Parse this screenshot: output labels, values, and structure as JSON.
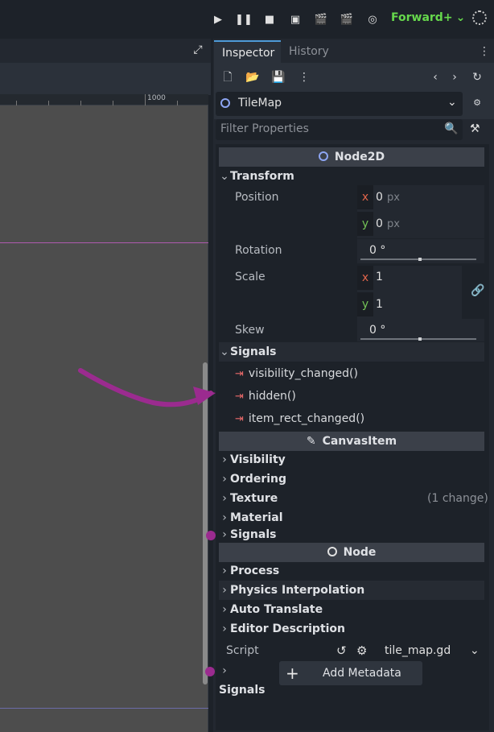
{
  "toolbar": {
    "renderer_label": "Forward+",
    "play_icon": "play-icon",
    "pause_icon": "pause-icon",
    "stop_icon": "stop-icon"
  },
  "viewport": {
    "ruler_label": "1000"
  },
  "inspector": {
    "tabs": [
      "Inspector",
      "History"
    ],
    "node_name": "TileMap",
    "filter_placeholder": "Filter Properties",
    "node2d_header": "Node2D",
    "transform_label": "Transform",
    "position_label": "Position",
    "position_x": "0",
    "position_y": "0",
    "unit_px": "px",
    "rotation_label": "Rotation",
    "rotation_value": "0 °",
    "scale_label": "Scale",
    "scale_x": "1",
    "scale_y": "1",
    "skew_label": "Skew",
    "skew_value": "0 °",
    "signals_label": "Signals",
    "signal_items": [
      "visibility_changed()",
      "hidden()",
      "item_rect_changed()"
    ],
    "canvasitem_header": "CanvasItem",
    "canvas_groups": [
      "Visibility",
      "Ordering",
      "Texture",
      "Material",
      "Signals"
    ],
    "texture_change": "(1 change)",
    "node_header": "Node",
    "node_groups": [
      "Process",
      "Physics Interpolation",
      "Auto Translate",
      "Editor Description"
    ],
    "script_label": "Script",
    "script_file": "tile_map.gd",
    "signals_bottom": "Signals",
    "add_metadata": "Add Metadata",
    "axis_x": "x",
    "axis_y": "y"
  },
  "colors": {
    "accent_blue": "#4e9ad8",
    "renderer_green": "#66d84c",
    "signal_red": "#ea6a6a",
    "annotation_purple": "#9b2b8f"
  }
}
